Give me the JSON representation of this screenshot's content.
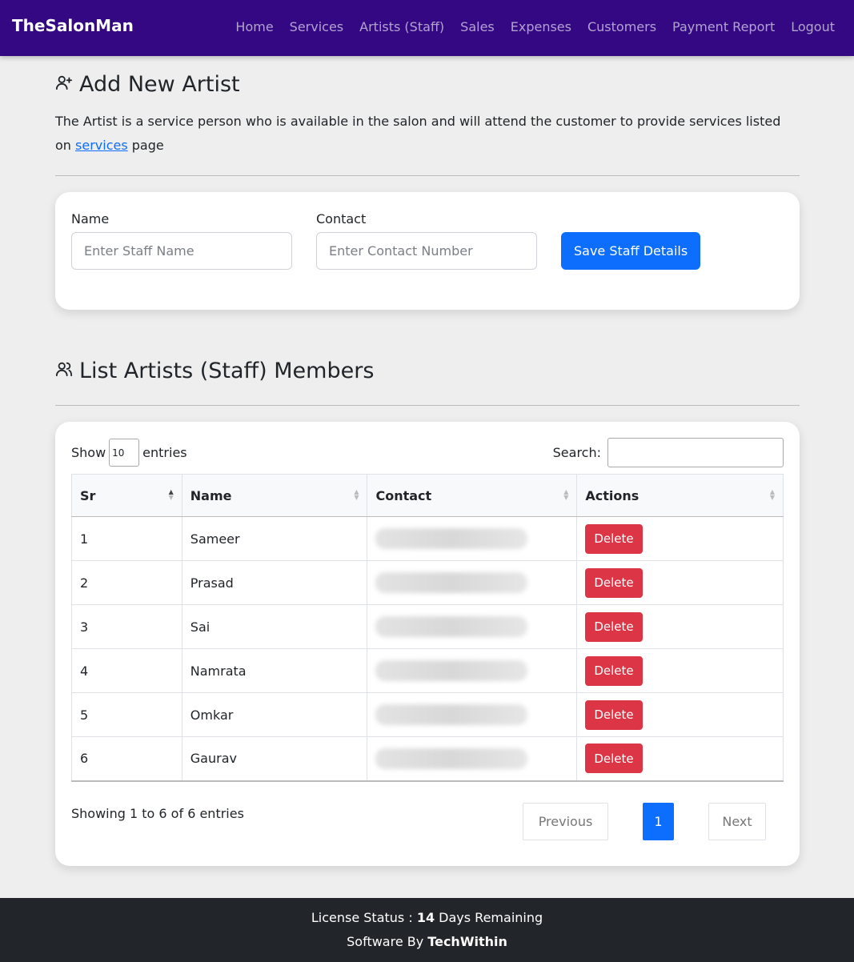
{
  "navbar": {
    "brand": "TheSalonMan",
    "links": [
      "Home",
      "Services",
      "Artists (Staff)",
      "Sales",
      "Expenses",
      "Customers",
      "Payment Report",
      "Logout"
    ]
  },
  "add_section": {
    "title": "Add New Artist",
    "icon": "user-plus-icon",
    "intro_before": "The Artist is a service person who is available in the salon and will attend the customer to provide services listed on ",
    "intro_link": "services",
    "intro_after": " page"
  },
  "form": {
    "name_label": "Name",
    "name_placeholder": "Enter Staff Name",
    "contact_label": "Contact",
    "contact_placeholder": "Enter Contact Number",
    "save_label": "Save Staff Details"
  },
  "list_section": {
    "title": "List Artists (Staff) Members",
    "icon": "users-icon"
  },
  "table_controls": {
    "show_label": "Show",
    "page_length": "10",
    "entries_label": "entries",
    "search_label": "Search:"
  },
  "table": {
    "headers": [
      "Sr",
      "Name",
      "Contact",
      "Actions"
    ],
    "rows": [
      {
        "sr": "1",
        "name": "Sameer",
        "action": "Delete"
      },
      {
        "sr": "2",
        "name": "Prasad",
        "action": "Delete"
      },
      {
        "sr": "3",
        "name": "Sai",
        "action": "Delete"
      },
      {
        "sr": "4",
        "name": "Namrata",
        "action": "Delete"
      },
      {
        "sr": "5",
        "name": "Omkar",
        "action": "Delete"
      },
      {
        "sr": "6",
        "name": "Gaurav",
        "action": "Delete"
      }
    ]
  },
  "pagination": {
    "info": "Showing 1 to 6 of 6 entries",
    "previous": "Previous",
    "current": "1",
    "next": "Next"
  },
  "footer": {
    "license_prefix": "License Status : ",
    "license_days": "14",
    "license_suffix": " Days Remaining",
    "software_prefix": "Software By ",
    "software_brand": "TechWithin"
  },
  "colors": {
    "navbar": "#330882",
    "primary": "#0d6efd",
    "danger": "#dc3545",
    "footer": "#222529"
  }
}
